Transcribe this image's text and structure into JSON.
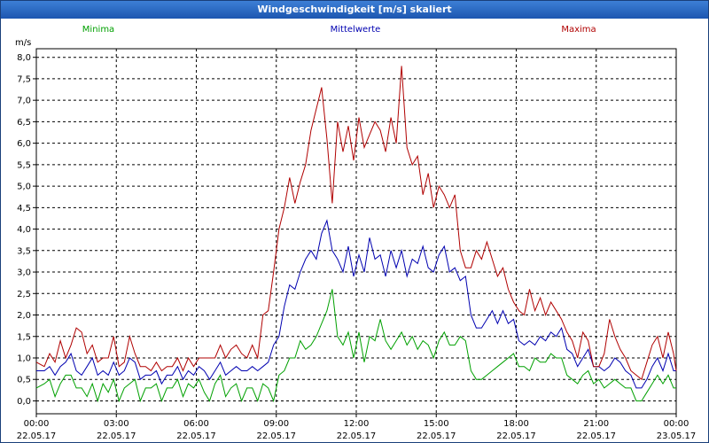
{
  "window": {
    "title": "Windgeschwindigkeit [m/s] skaliert"
  },
  "chart_data": {
    "type": "line",
    "title": "Windgeschwindigkeit [m/s] skaliert",
    "ylabel": "m/s",
    "ylim": [
      -0.3,
      8.2
    ],
    "y_ticks": [
      "0,0",
      "0,5",
      "1,0",
      "1,5",
      "2,0",
      "2,5",
      "3,0",
      "3,5",
      "4,0",
      "4,5",
      "5,0",
      "5,5",
      "6,0",
      "6,5",
      "7,0",
      "7,5",
      "8,0"
    ],
    "x_ticks": [
      {
        "time": "00:00",
        "date": "22.05.17"
      },
      {
        "time": "03:00",
        "date": "22.05.17"
      },
      {
        "time": "06:00",
        "date": "22.05.17"
      },
      {
        "time": "09:00",
        "date": "22.05.17"
      },
      {
        "time": "12:00",
        "date": "22.05.17"
      },
      {
        "time": "15:00",
        "date": "22.05.17"
      },
      {
        "time": "18:00",
        "date": "22.05.17"
      },
      {
        "time": "21:00",
        "date": "22.05.17"
      },
      {
        "time": "00:00",
        "date": "23.05.17"
      }
    ],
    "grid": true,
    "legend_placement": "top",
    "series": [
      {
        "name": "Minima",
        "color": "#00a000",
        "x": [
          0,
          0.3,
          0.5,
          0.7,
          0.9,
          1.1,
          1.3,
          1.5,
          1.7,
          1.9,
          2.1,
          2.3,
          2.5,
          2.7,
          2.9,
          3.1,
          3.3,
          3.5,
          3.7,
          3.9,
          4.1,
          4.3,
          4.5,
          4.7,
          4.9,
          5.1,
          5.3,
          5.5,
          5.7,
          5.9,
          6.1,
          6.3,
          6.5,
          6.7,
          6.9,
          7.1,
          7.3,
          7.5,
          7.7,
          7.9,
          8.1,
          8.3,
          8.5,
          8.7,
          8.9,
          9.1,
          9.3,
          9.5,
          9.7,
          9.9,
          10.1,
          10.3,
          10.5,
          10.7,
          10.9,
          11.1,
          11.3,
          11.5,
          11.7,
          11.9,
          12.1,
          12.3,
          12.5,
          12.7,
          12.9,
          13.1,
          13.3,
          13.5,
          13.7,
          13.9,
          14.1,
          14.3,
          14.5,
          14.7,
          14.9,
          15.1,
          15.3,
          15.5,
          15.7,
          15.9,
          16.1,
          16.3,
          16.5,
          16.7,
          16.9,
          17.1,
          17.3,
          17.5,
          17.7,
          17.9,
          18.1,
          18.3,
          18.5,
          18.7,
          18.9,
          19.1,
          19.3,
          19.5,
          19.7,
          19.9,
          20.1,
          20.3,
          20.5,
          20.7,
          20.9,
          21.1,
          21.3,
          21.5,
          21.7,
          21.9,
          22.1,
          22.3,
          22.5,
          22.7,
          22.9,
          23.1,
          23.3,
          23.5,
          23.7,
          23.9,
          24
        ],
        "y": [
          0.3,
          0.4,
          0.5,
          0.1,
          0.4,
          0.6,
          0.6,
          0.3,
          0.3,
          0.1,
          0.4,
          0.0,
          0.4,
          0.2,
          0.5,
          0.0,
          0.3,
          0.4,
          0.5,
          0.0,
          0.3,
          0.3,
          0.4,
          0.0,
          0.3,
          0.3,
          0.5,
          0.1,
          0.4,
          0.3,
          0.5,
          0.2,
          0.0,
          0.4,
          0.6,
          0.1,
          0.3,
          0.4,
          0.0,
          0.3,
          0.3,
          0.0,
          0.4,
          0.3,
          0.0,
          0.6,
          0.7,
          1.0,
          1.0,
          1.4,
          1.2,
          1.3,
          1.5,
          1.8,
          2.1,
          2.6,
          1.5,
          1.3,
          1.6,
          1.0,
          1.6,
          0.9,
          1.5,
          1.4,
          1.9,
          1.4,
          1.2,
          1.4,
          1.6,
          1.3,
          1.5,
          1.2,
          1.4,
          1.3,
          1.0,
          1.4,
          1.6,
          1.3,
          1.3,
          1.5,
          1.4,
          0.7,
          0.5,
          0.5,
          0.6,
          0.7,
          0.8,
          0.9,
          1.0,
          1.1,
          0.8,
          0.8,
          0.7,
          1.0,
          0.9,
          0.9,
          1.1,
          1.0,
          1.0,
          0.6,
          0.5,
          0.4,
          0.6,
          0.7,
          0.4,
          0.5,
          0.3,
          0.4,
          0.5,
          0.4,
          0.3,
          0.3,
          0.0,
          0.0,
          0.2,
          0.4,
          0.6,
          0.4,
          0.6,
          0.3,
          0.3
        ]
      },
      {
        "name": "Mittelwerte",
        "color": "#0000b0",
        "x": [
          0,
          0.3,
          0.5,
          0.7,
          0.9,
          1.1,
          1.3,
          1.5,
          1.7,
          1.9,
          2.1,
          2.3,
          2.5,
          2.7,
          2.9,
          3.1,
          3.3,
          3.5,
          3.7,
          3.9,
          4.1,
          4.3,
          4.5,
          4.7,
          4.9,
          5.1,
          5.3,
          5.5,
          5.7,
          5.9,
          6.1,
          6.3,
          6.5,
          6.7,
          6.9,
          7.1,
          7.3,
          7.5,
          7.7,
          7.9,
          8.1,
          8.3,
          8.5,
          8.7,
          8.9,
          9.1,
          9.3,
          9.5,
          9.7,
          9.9,
          10.1,
          10.3,
          10.5,
          10.7,
          10.9,
          11.1,
          11.3,
          11.5,
          11.7,
          11.9,
          12.1,
          12.3,
          12.5,
          12.7,
          12.9,
          13.1,
          13.3,
          13.5,
          13.7,
          13.9,
          14.1,
          14.3,
          14.5,
          14.7,
          14.9,
          15.1,
          15.3,
          15.5,
          15.7,
          15.9,
          16.1,
          16.3,
          16.5,
          16.7,
          16.9,
          17.1,
          17.3,
          17.5,
          17.7,
          17.9,
          18.1,
          18.3,
          18.5,
          18.7,
          18.9,
          19.1,
          19.3,
          19.5,
          19.7,
          19.9,
          20.1,
          20.3,
          20.5,
          20.7,
          20.9,
          21.1,
          21.3,
          21.5,
          21.7,
          21.9,
          22.1,
          22.3,
          22.5,
          22.7,
          22.9,
          23.1,
          23.3,
          23.5,
          23.7,
          23.9,
          24
        ],
        "y": [
          0.7,
          0.7,
          0.8,
          0.6,
          0.8,
          0.9,
          1.1,
          0.7,
          0.6,
          0.8,
          1.0,
          0.6,
          0.7,
          0.6,
          0.9,
          0.6,
          0.7,
          1.0,
          0.9,
          0.5,
          0.6,
          0.6,
          0.7,
          0.4,
          0.6,
          0.6,
          0.8,
          0.5,
          0.7,
          0.6,
          0.8,
          0.7,
          0.5,
          0.7,
          0.9,
          0.6,
          0.7,
          0.8,
          0.7,
          0.7,
          0.8,
          0.7,
          0.8,
          0.9,
          1.3,
          1.5,
          2.2,
          2.7,
          2.6,
          3.0,
          3.3,
          3.5,
          3.3,
          3.9,
          4.2,
          3.5,
          3.3,
          3.0,
          3.6,
          2.9,
          3.4,
          3.0,
          3.8,
          3.3,
          3.4,
          2.9,
          3.5,
          3.1,
          3.5,
          2.9,
          3.3,
          3.2,
          3.6,
          3.1,
          3.0,
          3.4,
          3.6,
          3.0,
          3.1,
          2.8,
          2.9,
          2.0,
          1.7,
          1.7,
          1.9,
          2.1,
          1.8,
          2.1,
          1.8,
          1.9,
          1.4,
          1.3,
          1.4,
          1.3,
          1.5,
          1.4,
          1.6,
          1.5,
          1.7,
          1.2,
          1.1,
          0.8,
          1.0,
          1.2,
          0.8,
          0.8,
          0.7,
          0.8,
          1.0,
          0.9,
          0.7,
          0.6,
          0.3,
          0.3,
          0.5,
          0.8,
          1.0,
          0.7,
          1.1,
          0.7,
          0.7
        ]
      },
      {
        "name": "Maxima",
        "color": "#b00000",
        "x": [
          0,
          0.3,
          0.5,
          0.7,
          0.9,
          1.1,
          1.3,
          1.5,
          1.7,
          1.9,
          2.1,
          2.3,
          2.5,
          2.7,
          2.9,
          3.1,
          3.3,
          3.5,
          3.7,
          3.9,
          4.1,
          4.3,
          4.5,
          4.7,
          4.9,
          5.1,
          5.3,
          5.5,
          5.7,
          5.9,
          6.1,
          6.3,
          6.5,
          6.7,
          6.9,
          7.1,
          7.3,
          7.5,
          7.7,
          7.9,
          8.1,
          8.3,
          8.5,
          8.7,
          8.9,
          9.1,
          9.3,
          9.5,
          9.7,
          9.9,
          10.1,
          10.3,
          10.5,
          10.7,
          10.9,
          11.1,
          11.3,
          11.5,
          11.7,
          11.9,
          12.1,
          12.3,
          12.5,
          12.7,
          12.9,
          13.1,
          13.3,
          13.5,
          13.7,
          13.9,
          14.1,
          14.3,
          14.5,
          14.7,
          14.9,
          15.1,
          15.3,
          15.5,
          15.7,
          15.9,
          16.1,
          16.3,
          16.5,
          16.7,
          16.9,
          17.1,
          17.3,
          17.5,
          17.7,
          17.9,
          18.1,
          18.3,
          18.5,
          18.7,
          18.9,
          19.1,
          19.3,
          19.5,
          19.7,
          19.9,
          20.1,
          20.3,
          20.5,
          20.7,
          20.9,
          21.1,
          21.3,
          21.5,
          21.7,
          21.9,
          22.1,
          22.3,
          22.5,
          22.7,
          22.9,
          23.1,
          23.3,
          23.5,
          23.7,
          23.9,
          24
        ],
        "y": [
          0.9,
          0.8,
          1.1,
          0.9,
          1.4,
          1.0,
          1.3,
          1.7,
          1.6,
          1.1,
          1.3,
          0.9,
          1.0,
          1.0,
          1.5,
          0.8,
          0.9,
          1.5,
          1.1,
          0.8,
          0.8,
          0.7,
          0.9,
          0.7,
          0.8,
          0.8,
          1.0,
          0.7,
          1.0,
          0.8,
          1.0,
          1.0,
          1.0,
          1.0,
          1.3,
          1.0,
          1.2,
          1.3,
          1.1,
          1.0,
          1.3,
          1.0,
          2.0,
          2.1,
          3.0,
          4.0,
          4.5,
          5.2,
          4.6,
          5.1,
          5.5,
          6.3,
          6.8,
          7.3,
          6.1,
          4.6,
          6.5,
          5.8,
          6.4,
          5.6,
          6.6,
          5.9,
          6.2,
          6.5,
          6.3,
          5.8,
          6.6,
          6.0,
          7.8,
          5.9,
          5.5,
          5.7,
          4.8,
          5.3,
          4.5,
          5.0,
          4.8,
          4.5,
          4.8,
          3.5,
          3.1,
          3.1,
          3.5,
          3.3,
          3.7,
          3.3,
          2.9,
          3.1,
          2.6,
          2.3,
          2.1,
          2.0,
          2.6,
          2.1,
          2.4,
          2.0,
          2.3,
          2.1,
          1.9,
          1.6,
          1.4,
          1.0,
          1.6,
          1.4,
          0.8,
          0.8,
          1.1,
          1.9,
          1.5,
          1.2,
          1.0,
          0.7,
          0.6,
          0.5,
          0.9,
          1.3,
          1.5,
          1.0,
          1.6,
          1.1,
          0.7
        ]
      }
    ]
  }
}
